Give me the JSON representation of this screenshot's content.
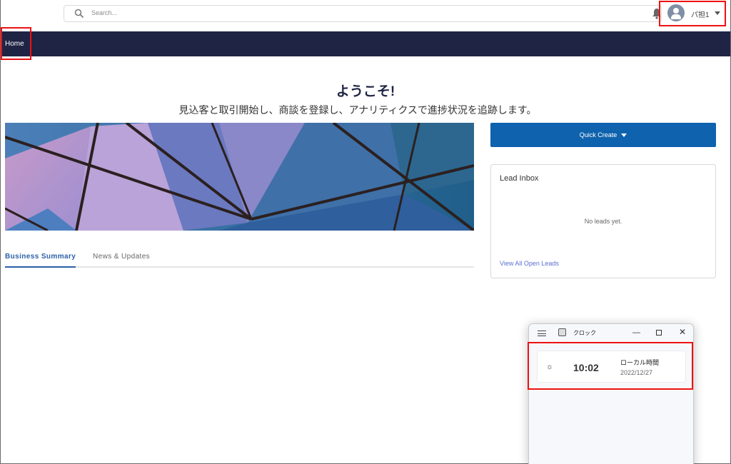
{
  "header": {
    "search_placeholder": "Search...",
    "user_name": "パ担1"
  },
  "nav": {
    "home_label": "Home"
  },
  "welcome": {
    "title": "ようこそ!",
    "subtitle": "見込客と取引開始し、商談を登録し、アナリティクスで進捗状況を追跡します。"
  },
  "tabs": [
    {
      "label": "Business Summary",
      "active": true
    },
    {
      "label": "News & Updates",
      "active": false
    }
  ],
  "quick_create": {
    "label": "Quick Create"
  },
  "lead_inbox": {
    "title": "Lead Inbox",
    "empty_text": "No leads yet.",
    "link_text": "View All Open Leads"
  },
  "clock_app": {
    "title": "クロック",
    "minimize": "—",
    "close": "✕",
    "icon_sun": "☼",
    "time": "10:02",
    "location": "ローカル時間",
    "date": "2022/12/27"
  },
  "colors": {
    "nav_bg": "#1f2444",
    "accent": "#0f62ad",
    "tab_active": "#2b5fa8",
    "link": "#5b6fd1",
    "highlight": "#ee1111"
  }
}
